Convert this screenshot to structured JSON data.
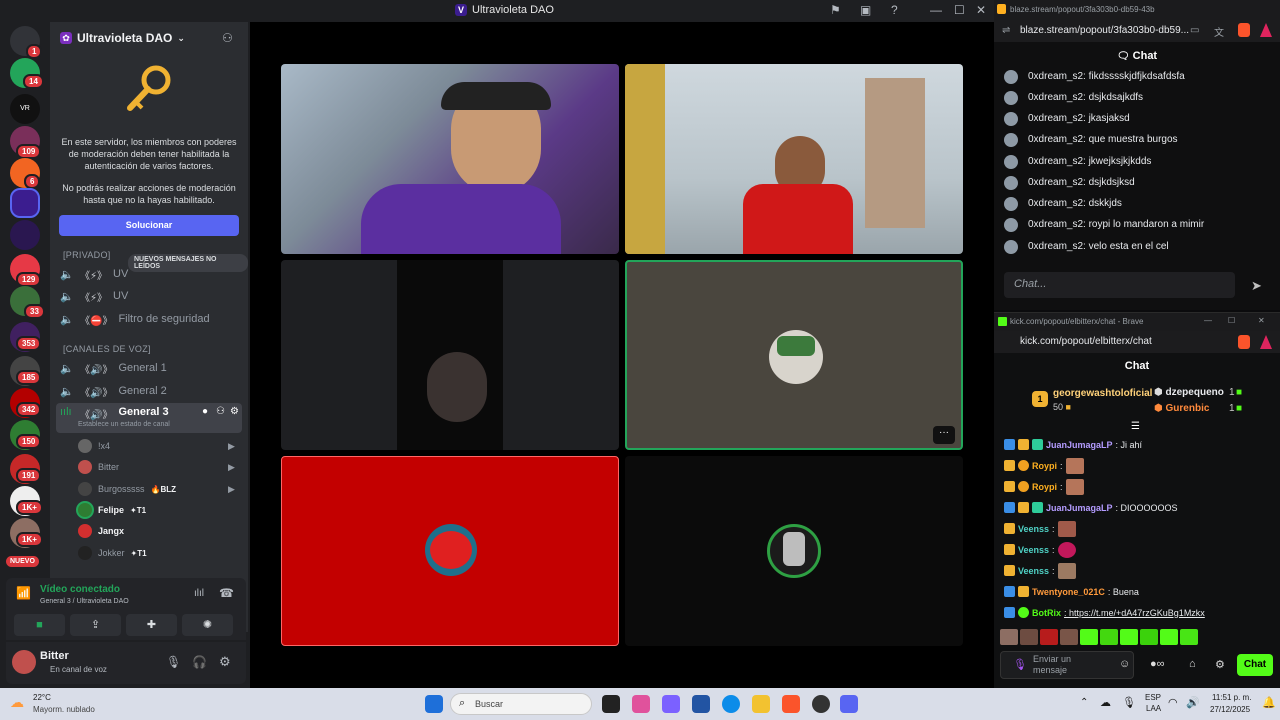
{
  "window": {
    "title": "Ultravioleta DAO"
  },
  "rail": {
    "badges": [
      "1",
      "14",
      "109",
      "6",
      "129",
      "33",
      "353",
      "185",
      "342",
      "150",
      "191",
      "1K+",
      "1K+"
    ],
    "new_label": "NUEVO"
  },
  "guild": {
    "name": "Ultravioleta DAO",
    "notice1": "En este servidor, los miembros con poderes de moderación deben tener habilitada la autenticación de varios factores.",
    "notice2": "No podrás realizar acciones de moderación hasta que no la hayas habilitado.",
    "fix_button": "Solucionar",
    "unread_pill": "NUEVOS MENSAJES NO LEÍDOS",
    "private_cat": "[PRIVADO]",
    "text_channels": [
      {
        "label": "UV"
      },
      {
        "label": "UV"
      },
      {
        "label": "Filtro de seguridad"
      }
    ],
    "voice_cat": "[CANALES DE VOZ]",
    "voice_channels": [
      {
        "label": "General 1"
      },
      {
        "label": "General 2"
      },
      {
        "label": "General 3"
      }
    ],
    "status_hint": "Establece un estado de canal",
    "members": [
      {
        "name": "!x4",
        "tag": ""
      },
      {
        "name": "Bitter",
        "tag": ""
      },
      {
        "name": "Burgosssss",
        "tag": "BLZ"
      },
      {
        "name": "Felipe",
        "tag": "T1"
      },
      {
        "name": "Jangx",
        "tag": ""
      },
      {
        "name": "Jokker",
        "tag": "T1"
      }
    ]
  },
  "voice_panel": {
    "status": "Vídeo conectado",
    "location": "General 3 / Ultravioleta DAO"
  },
  "user": {
    "name": "Bitter",
    "status": "En canal de voz"
  },
  "blaze": {
    "tab_url": "blaze.stream/popout/3fa303b0-db59-43b",
    "url": "blaze.stream/popout/3fa303b0-db59...",
    "chat_title": "Chat",
    "messages": [
      "0xdream_s2: fikdsssskjdfjkdsafdsfa",
      "0xdream_s2: dsjkdsajkdfs",
      "0xdream_s2: jkasjaksd",
      "0xdream_s2: que muestra burgos",
      "0xdream_s2: jkwejksjkjkdds",
      "0xdream_s2: dsjkdsjksd",
      "0xdream_s2: dskkjds",
      "0xdream_s2: roypi lo mandaron a mimir",
      "0xdream_s2: velo esta en el cel"
    ],
    "input_placeholder": "Chat..."
  },
  "kick": {
    "tab_url": "kick.com/popout/elbitterx/chat - Brave",
    "url": "kick.com/popout/elbitterx/chat",
    "chat_title": "Chat",
    "leader1_name": "georgewashtoloficial",
    "leader1_points": "50",
    "leader2_name": "dzepequeno",
    "leader2_points": "1",
    "leader3_name": "Gurenbic",
    "leader3_points": "1",
    "messages": [
      {
        "user": "JuanJumagaLP",
        "text": ": Ji ahí",
        "color": "#b49cff"
      },
      {
        "user": "Roypi",
        "text": ":",
        "color": "#ffb020"
      },
      {
        "user": "Roypi",
        "text": ":",
        "color": "#ffb020"
      },
      {
        "user": "JuanJumagaLP",
        "text": ": DIOOOOOOS",
        "color": "#b49cff"
      },
      {
        "user": "Veenss",
        "text": ":",
        "color": "#4fd1c5"
      },
      {
        "user": "Veenss",
        "text": ":",
        "color": "#4fd1c5"
      },
      {
        "user": "Veenss",
        "text": ":",
        "color": "#4fd1c5"
      },
      {
        "user": "Twentyone_021C",
        "text": ": Buena",
        "color": "#ff9a3c"
      },
      {
        "user": "BotRix",
        "text": ": https://t.me/+dA47rzGKuBg1Mzkx",
        "color": "#53fc18"
      }
    ],
    "input_placeholder": "Enviar un mensaje",
    "chat_button": "Chat"
  },
  "taskbar": {
    "weather_temp": "22°C",
    "weather_desc": "Mayorm. nublado",
    "search_placeholder": "Buscar",
    "lang": "ESP",
    "lang2": "LAA",
    "time": "11:51 p. m.",
    "date": "27/12/2025"
  }
}
